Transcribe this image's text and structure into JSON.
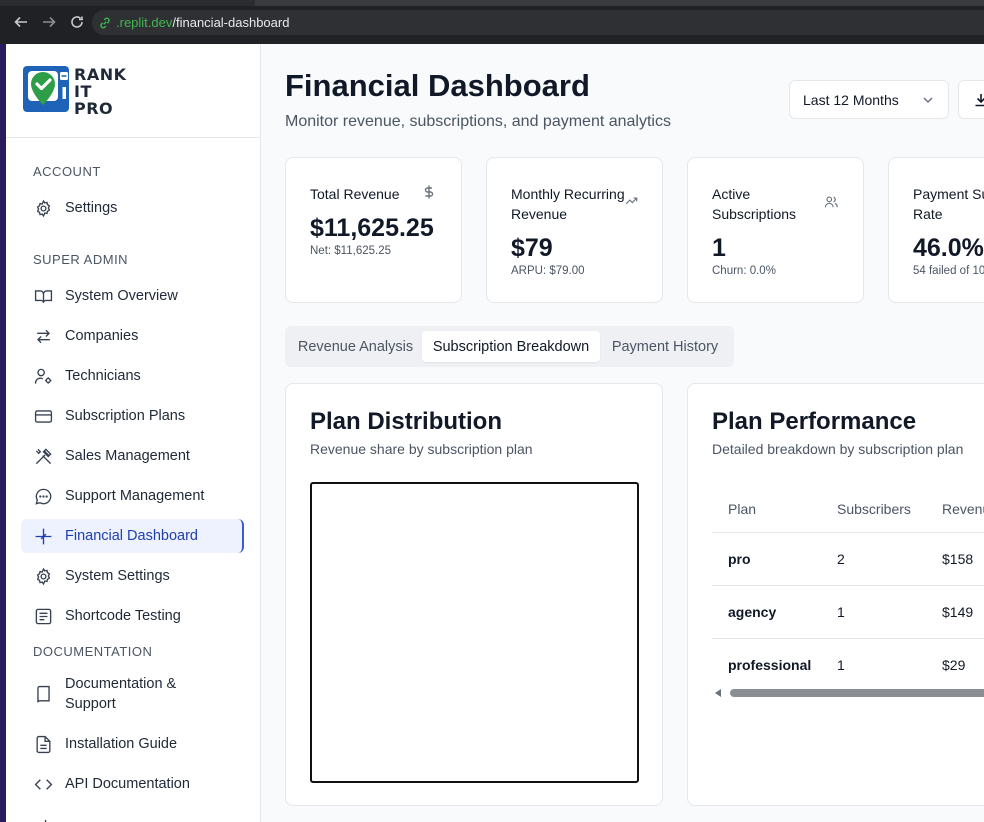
{
  "browser": {
    "url_host": ".replit.dev",
    "url_path": "/financial-dashboard"
  },
  "brand": {
    "line1": "RANK",
    "line2": "IT",
    "line3": "PRO",
    "accent": "#1e63b8",
    "check_color": "#2e9d48"
  },
  "sidebar": {
    "sections": {
      "account": "ACCOUNT",
      "super_admin": "SUPER ADMIN",
      "documentation": "DOCUMENTATION"
    },
    "items": [
      {
        "label": "Settings",
        "icon": "gear-icon"
      },
      {
        "label": "System Overview",
        "icon": "book-open-icon"
      },
      {
        "label": "Companies",
        "icon": "arrows-left-right-icon"
      },
      {
        "label": "Technicians",
        "icon": "user-cog-icon"
      },
      {
        "label": "Subscription Plans",
        "icon": "credit-card-icon"
      },
      {
        "label": "Sales Management",
        "icon": "crossed-tools-icon"
      },
      {
        "label": "Support Management",
        "icon": "chat-bubble-icon"
      },
      {
        "label": "Financial Dashboard",
        "icon": "sparkle-icon",
        "active": true
      },
      {
        "label": "System Settings",
        "icon": "gear-icon"
      },
      {
        "label": "Shortcode Testing",
        "icon": "document-lines-icon"
      },
      {
        "label": "Documentation & Support",
        "icon": "book-icon"
      },
      {
        "label": "Installation Guide",
        "icon": "file-text-icon"
      },
      {
        "label": "API Documentation",
        "icon": "code-brackets-icon"
      }
    ]
  },
  "header": {
    "title": "Financial Dashboard",
    "subtitle": "Monitor revenue, subscriptions, and payment analytics",
    "period_select": "Last 12 Months"
  },
  "stats": [
    {
      "title": "Total Revenue",
      "value": "$11,625.25",
      "sub": "Net: $11,625.25",
      "icon": "dollar-icon"
    },
    {
      "title": "Monthly Recurring Revenue",
      "value": "$79",
      "sub": "ARPU: $79.00",
      "icon": "trending-up-icon"
    },
    {
      "title": "Active Subscriptions",
      "value": "1",
      "sub": "Churn: 0.0%",
      "icon": "users-icon"
    },
    {
      "title": "Payment Su­ccess Rate",
      "value": "46.0%",
      "sub": "54 failed of 10",
      "icon": "check-icon"
    }
  ],
  "tabs": [
    {
      "label": "Revenue Analysis"
    },
    {
      "label": "Subscription Breakdown",
      "active": true
    },
    {
      "label": "Payment History"
    }
  ],
  "plan_distribution": {
    "title": "Plan Distribution",
    "description": "Revenue share by subscription plan"
  },
  "plan_performance": {
    "title": "Plan Performance",
    "description": "Detailed breakdown by subscription plan",
    "columns": [
      "Plan",
      "Subscribers",
      "Revenu"
    ],
    "rows": [
      [
        "pro",
        "2",
        "$158"
      ],
      [
        "agency",
        "1",
        "$149"
      ],
      [
        "professional",
        "1",
        "$29"
      ]
    ]
  }
}
